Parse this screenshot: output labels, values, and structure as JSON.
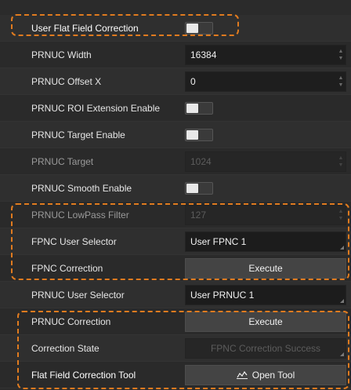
{
  "rows": [
    {
      "label": "User Flat Field Correction",
      "kind": "toggle",
      "on": false
    },
    {
      "label": "PRNUC Width",
      "kind": "spin",
      "value": "16384",
      "disabled": false
    },
    {
      "label": "PRNUC Offset X",
      "kind": "spin",
      "value": "0",
      "disabled": false
    },
    {
      "label": "PRNUC ROI Extension Enable",
      "kind": "toggle",
      "on": false
    },
    {
      "label": "PRNUC Target Enable",
      "kind": "toggle",
      "on": false
    },
    {
      "label": "PRNUC Target",
      "kind": "spin",
      "value": "1024",
      "disabled": true
    },
    {
      "label": "PRNUC Smooth Enable",
      "kind": "toggle",
      "on": false
    },
    {
      "label": "PRNUC LowPass Filter",
      "kind": "spin",
      "value": "127",
      "disabled": true
    },
    {
      "label": "FPNC User Selector",
      "kind": "select",
      "value": "User FPNC 1",
      "disabled": false
    },
    {
      "label": "FPNC Correction",
      "kind": "button",
      "value": "Execute"
    },
    {
      "label": "PRNUC User Selector",
      "kind": "select",
      "value": "User PRNUC 1",
      "disabled": false
    },
    {
      "label": "PRNUC Correction",
      "kind": "button",
      "value": "Execute"
    },
    {
      "label": "Correction State",
      "kind": "select",
      "value": "FPNC Correction Success",
      "disabled": true
    },
    {
      "label": "Flat Field Correction Tool",
      "kind": "button",
      "value": "Open Tool",
      "icon": "chart-tool-icon"
    }
  ],
  "colors": {
    "highlight": "#e07b1f"
  }
}
